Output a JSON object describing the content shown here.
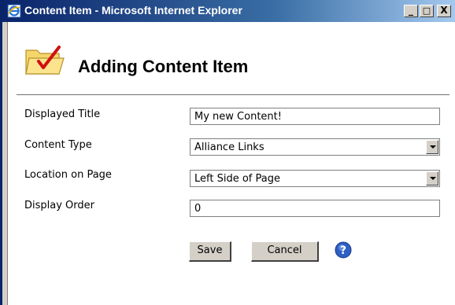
{
  "window": {
    "title": "Content Item - Microsoft Internet Explorer",
    "minimize_glyph": "_",
    "maximize_glyph": "□",
    "close_glyph": "X"
  },
  "dialog": {
    "heading": "Adding Content Item",
    "icon": "folder-check-icon"
  },
  "form": {
    "title_label": "Displayed Title",
    "title_value": "My new Content!",
    "type_label": "Content Type",
    "type_value": "Alliance Links",
    "location_label": "Location on Page",
    "location_value": "Left Side of Page",
    "order_label": "Display Order",
    "order_value": "0"
  },
  "buttons": {
    "save": "Save",
    "cancel": "Cancel",
    "help_icon": "help-icon"
  },
  "colors": {
    "titlebar_start": "#0a246a",
    "titlebar_end": "#a6caf0",
    "button_face": "#d4d0c8"
  }
}
